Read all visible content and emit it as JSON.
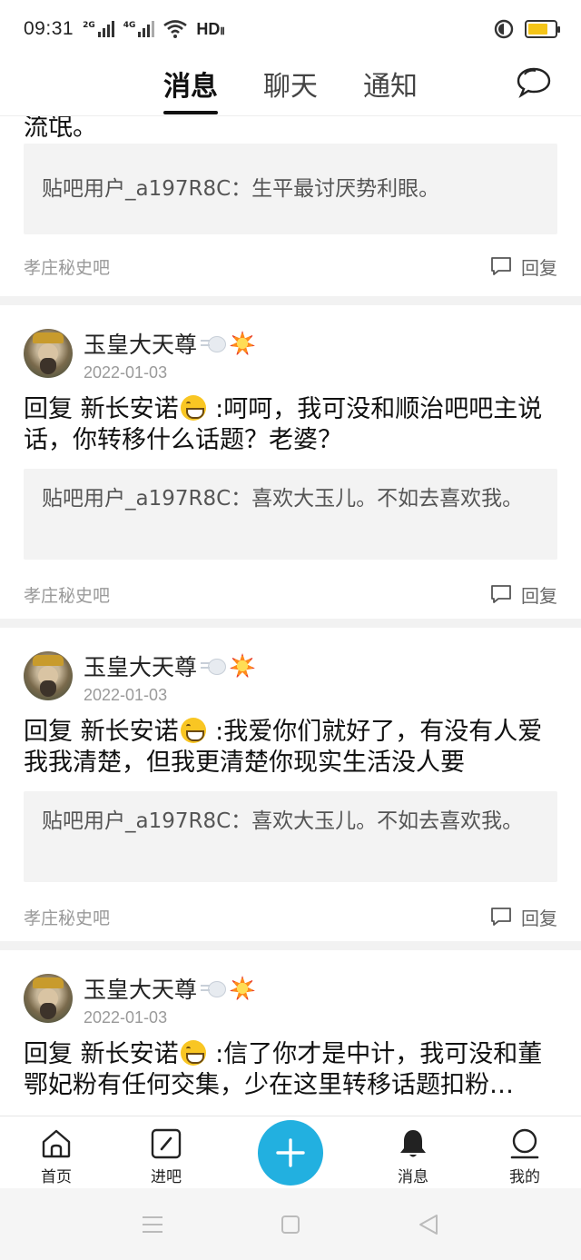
{
  "status": {
    "time": "09:31",
    "net1": "2G",
    "net2": "4G",
    "hd": "HD",
    "hd_sub": "Ⅱ",
    "battery_level": 0.75
  },
  "tabs": [
    {
      "label": "消息"
    },
    {
      "label": "聊天"
    },
    {
      "label": "通知"
    }
  ],
  "active_tab": "消息",
  "top_card": {
    "partial_text": "流氓。",
    "quote": "贴吧用户_a197R8C：生平最讨厌势利眼。",
    "bar": "孝庄秘史吧",
    "reply": "回复"
  },
  "posts": [
    {
      "username": "玉皇大天尊",
      "date": "2022-01-03",
      "content_prefix": "回复  新长安诺",
      "content_suffix": " :呵呵，我可没和顺治吧吧主说话，你转移什么话题？老婆？",
      "quote": "贴吧用户_a197R8C：喜欢大玉儿。不如去喜欢我。",
      "bar": "孝庄秘史吧",
      "reply": "回复"
    },
    {
      "username": "玉皇大天尊",
      "date": "2022-01-03",
      "content_prefix": "回复  新长安诺",
      "content_suffix": " :我爱你们就好了，有没有人爱我我清楚，但我更清楚你现实生活没人要",
      "quote": "贴吧用户_a197R8C：喜欢大玉儿。不如去喜欢我。",
      "bar": "孝庄秘史吧",
      "reply": "回复"
    },
    {
      "username": "玉皇大天尊",
      "date": "2022-01-03",
      "content_prefix": "回复  新长安诺",
      "content_suffix": " :信了你才是中计，我可没和董鄂妃粉有任何交集，少在这里转移话题扣粉…",
      "quote": "",
      "bar": "",
      "reply": ""
    }
  ],
  "bottom_nav": [
    {
      "label": "首页",
      "icon": "home-icon"
    },
    {
      "label": "进吧",
      "icon": "enter-bar-icon"
    },
    {
      "label": "",
      "icon": "plus-icon"
    },
    {
      "label": "消息",
      "icon": "bell-icon"
    },
    {
      "label": "我的",
      "icon": "profile-icon"
    }
  ],
  "colors": {
    "accent": "#22b0e0",
    "battery": "#f5c518"
  }
}
